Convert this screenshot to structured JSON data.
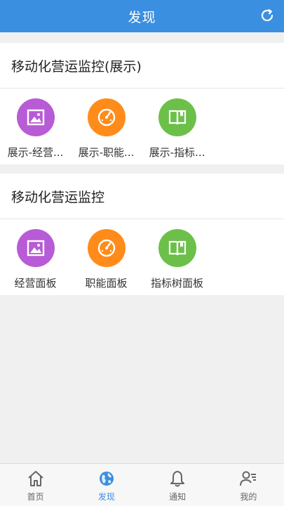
{
  "header": {
    "title": "发现"
  },
  "sections": [
    {
      "title": "移动化营运监控(展示)",
      "items": [
        {
          "label": "展示-经营...",
          "icon": "image-icon",
          "color": "#b85bd6"
        },
        {
          "label": "展示-职能...",
          "icon": "gauge-icon",
          "color": "#ff8c1a"
        },
        {
          "label": "展示-指标...",
          "icon": "book-icon",
          "color": "#6cc04a"
        }
      ]
    },
    {
      "title": "移动化营运监控",
      "items": [
        {
          "label": "经营面板",
          "icon": "image-icon",
          "color": "#b85bd6"
        },
        {
          "label": "职能面板",
          "icon": "gauge-icon",
          "color": "#ff8c1a"
        },
        {
          "label": "指标树面板",
          "icon": "book-icon",
          "color": "#6cc04a"
        }
      ]
    }
  ],
  "tabbar": {
    "items": [
      {
        "label": "首页",
        "icon": "home-icon"
      },
      {
        "label": "发现",
        "icon": "globe-icon",
        "active": true
      },
      {
        "label": "通知",
        "icon": "bell-icon"
      },
      {
        "label": "我的",
        "icon": "profile-icon"
      }
    ]
  },
  "colors": {
    "accent": "#3b8fe0",
    "purple": "#b85bd6",
    "orange": "#ff8c1a",
    "green": "#6cc04a"
  }
}
